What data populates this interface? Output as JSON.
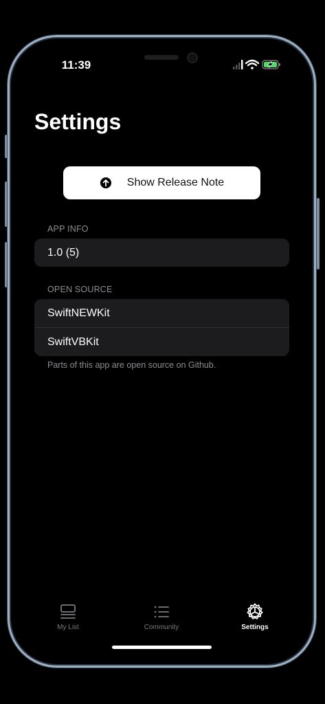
{
  "status_bar": {
    "time": "11:39"
  },
  "settings": {
    "title": "Settings",
    "release_note_button": "Show Release Note",
    "app_info": {
      "header": "APP INFO",
      "version": "1.0 (5)"
    },
    "open_source": {
      "header": "OPEN SOURCE",
      "items": [
        "SwiftNEWKit",
        "SwiftVBKit"
      ],
      "footer": "Parts of this app are open source on Github."
    }
  },
  "tab_bar": {
    "tabs": [
      {
        "label": "My List",
        "icon": "list-box-icon",
        "active": false
      },
      {
        "label": "Community",
        "icon": "bullet-list-icon",
        "active": false
      },
      {
        "label": "Settings",
        "icon": "gear-icon",
        "active": true
      }
    ]
  },
  "colors": {
    "background": "#000000",
    "group_background": "#1c1c1e",
    "secondary_text": "#8d8d93",
    "battery_green": "#4cd964"
  }
}
